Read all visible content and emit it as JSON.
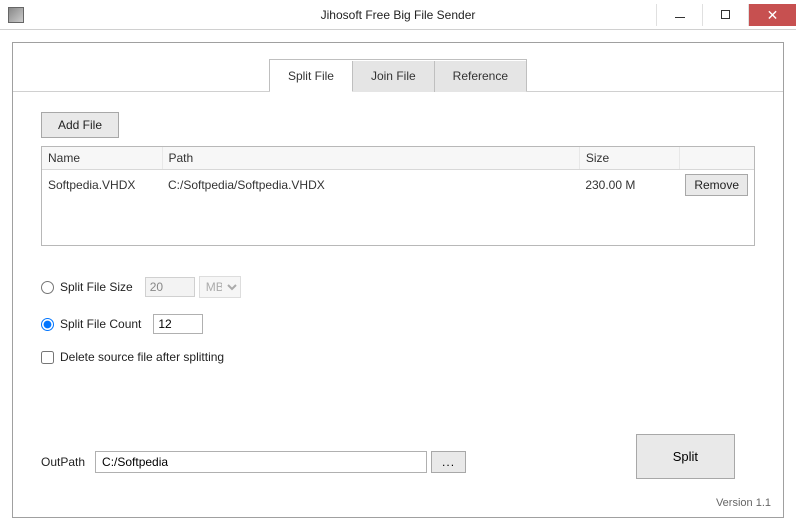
{
  "window": {
    "title": "Jihosoft Free Big File Sender"
  },
  "tabs": {
    "split": "Split File",
    "join": "Join File",
    "reference": "Reference",
    "active": "split"
  },
  "buttons": {
    "add_file": "Add File",
    "remove": "Remove",
    "browse": "...",
    "split": "Split"
  },
  "table": {
    "headers": {
      "name": "Name",
      "path": "Path",
      "size": "Size"
    },
    "rows": [
      {
        "name": "Softpedia.VHDX",
        "path": "C:/Softpedia/Softpedia.VHDX",
        "size": "230.00 M"
      }
    ]
  },
  "options": {
    "split_size_label": "Split File Size",
    "split_size_value": "20",
    "split_size_unit": "MB",
    "split_count_label": "Split File Count",
    "split_count_value": "12",
    "delete_source_label": "Delete source file after splitting",
    "mode": "count",
    "delete_source_checked": false
  },
  "outpath": {
    "label": "OutPath",
    "value": "C:/Softpedia"
  },
  "footer": {
    "version": "Version 1.1"
  }
}
